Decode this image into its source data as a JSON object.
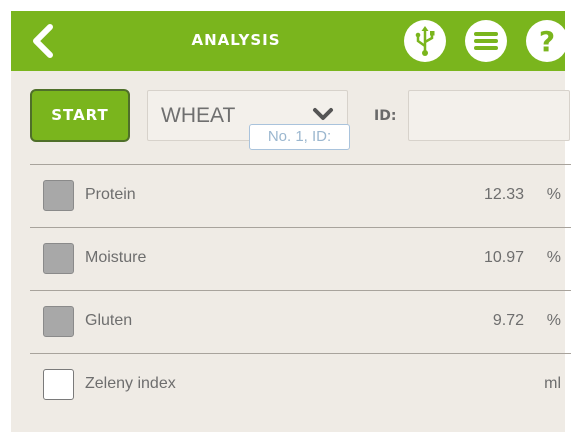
{
  "header": {
    "title": "ANALYSIS",
    "back_icon": "chevron-left-icon",
    "usb_icon": "usb-icon",
    "menu_icon": "menu-icon",
    "help_icon": "help-icon",
    "accent_color": "#7ab51d"
  },
  "controls": {
    "start_label": "START",
    "grain_selected": "WHEAT",
    "sample_tooltip": "No. 1, ID:",
    "id_label": "ID:",
    "id_value": ""
  },
  "parameters": [
    {
      "name": "Protein",
      "value": "12.33",
      "unit": "%",
      "checked": true
    },
    {
      "name": "Moisture",
      "value": "10.97",
      "unit": "%",
      "checked": true
    },
    {
      "name": "Gluten",
      "value": "9.72",
      "unit": "%",
      "checked": true
    },
    {
      "name": "Zeleny index",
      "value": "",
      "unit": "ml",
      "checked": false
    }
  ]
}
